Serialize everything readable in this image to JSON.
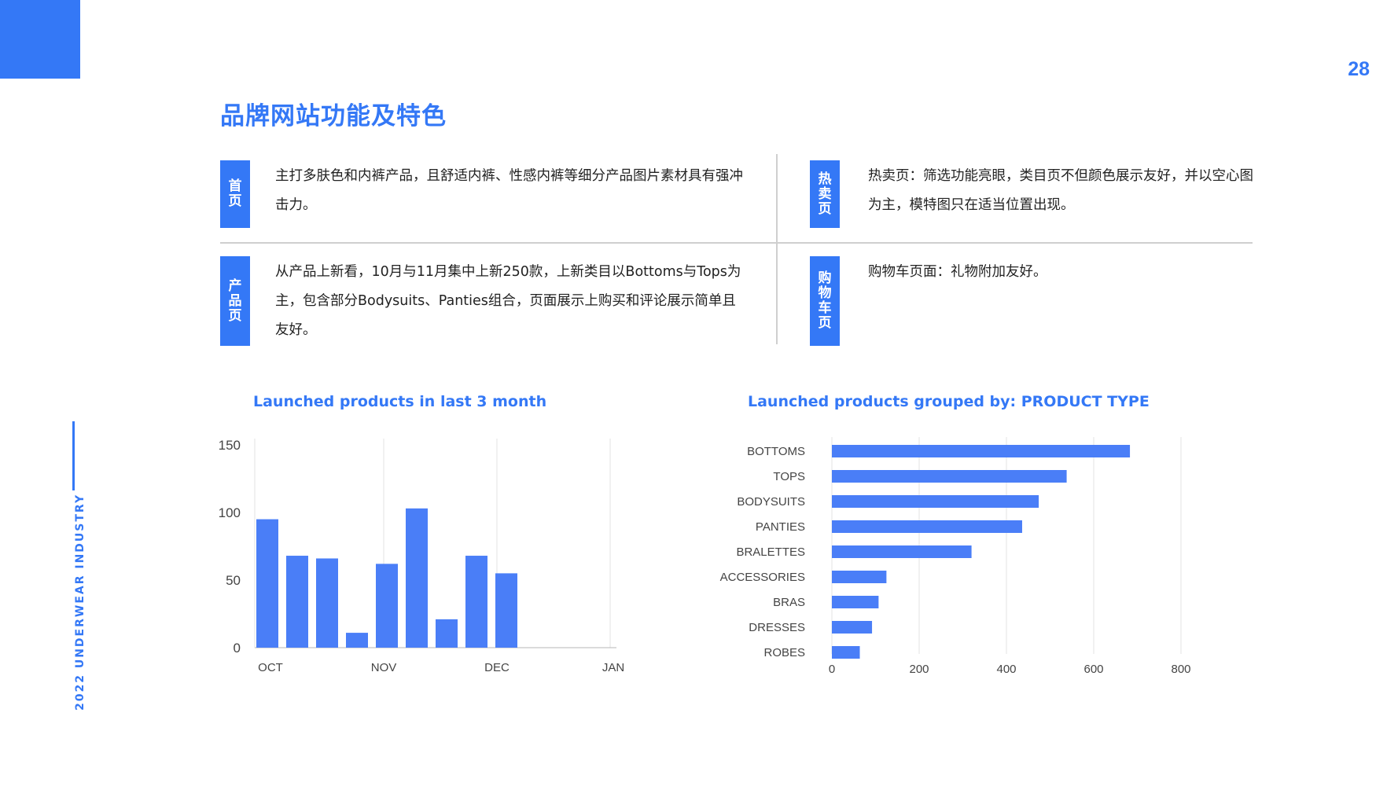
{
  "page": {
    "number": "28",
    "side_label": "2022 UNDERWEAR INDUSTRY",
    "title": "品牌网站功能及特色"
  },
  "colors": {
    "accent": "#3478f6",
    "bar": "#4a7ef7",
    "grid": "#e3e3e3"
  },
  "features": {
    "home": {
      "tag": "首页",
      "text": "主打多肤色和内裤产品，且舒适内裤、性感内裤等细分产品图片素材具有强冲击力。"
    },
    "product": {
      "tag": "产品页",
      "text": "从产品上新看，10月与11月集中上新250款，上新类目以Bottoms与Tops为主，包含部分Bodysuits、Panties组合，页面展示上购买和评论展示简单且友好。"
    },
    "hot": {
      "tag": "热卖页",
      "text": "热卖页：筛选功能亮眼，类目页不但颜色展示友好，并以空心图为主，模特图只在适当位置出现。"
    },
    "cart": {
      "tag": "购物车页",
      "text": "购物车页面：礼物附加友好。"
    }
  },
  "chart_data": [
    {
      "type": "bar",
      "title": "Launched products in last 3 month",
      "x_ticks": [
        "OCT",
        "NOV",
        "DEC",
        "JAN"
      ],
      "values": [
        95,
        68,
        66,
        11,
        62,
        103,
        21,
        68,
        55
      ],
      "ylim": [
        0,
        150
      ],
      "y_ticks": [
        0,
        50,
        100,
        150
      ],
      "grid": "vertical"
    },
    {
      "type": "bar",
      "orientation": "horizontal",
      "title": "Launched products grouped by: PRODUCT TYPE",
      "categories": [
        "BOTTOMS",
        "TOPS",
        "BODYSUITS",
        "PANTIES",
        "BRALETTES",
        "ACCESSORIES",
        "BRAS",
        "DRESSES",
        "ROBES"
      ],
      "values": [
        683,
        538,
        474,
        436,
        320,
        125,
        107,
        92,
        64
      ],
      "xlim": [
        0,
        800
      ],
      "x_ticks": [
        0,
        200,
        400,
        600,
        800
      ],
      "grid": "vertical"
    }
  ]
}
